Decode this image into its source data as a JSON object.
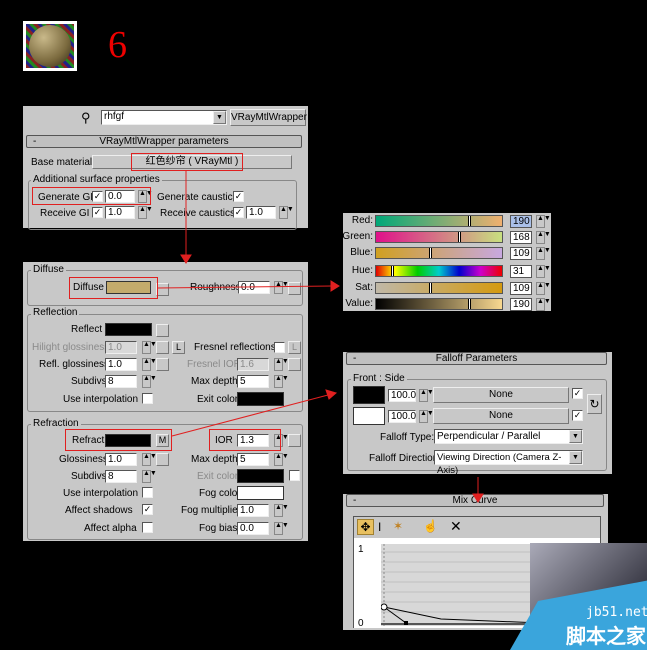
{
  "step_number": "6",
  "wrapper": {
    "material_name": "rhfgf",
    "type_button": "VRayMtlWrapper",
    "rollout_title": "VRayMtlWrapper parameters",
    "base_material_label": "Base material:",
    "base_material_value": "红色纱帘 ( VRayMtl )",
    "group_title": "Additional surface properties",
    "generate_gi_label": "Generate GI",
    "generate_gi_value": "0.0",
    "receive_gi_label": "Receive GI",
    "receive_gi_value": "1.0",
    "generate_caustics_label": "Generate caustics",
    "receive_caustics_label": "Receive caustics",
    "receive_caustics_value": "1.0",
    "check": "✓"
  },
  "vray": {
    "diffuse_group": "Diffuse",
    "diffuse_label": "Diffuse",
    "diffuse_color": "#c4ab6c",
    "roughness_label": "Roughness",
    "roughness_value": "0.0",
    "reflection_group": "Reflection",
    "reflect_label": "Reflect",
    "hilight_label": "Hilight glossiness",
    "hilight_value": "1.0",
    "l_button": "L",
    "fresnel_label": "Fresnel reflections",
    "refl_gloss_label": "Refl. glossiness",
    "refl_gloss_value": "1.0",
    "fresnel_ior_label": "Fresnel IOR",
    "fresnel_ior_value": "1.6",
    "subdivs_label": "Subdivs",
    "subdivs_value": "8",
    "max_depth_label": "Max depth",
    "max_depth_value": "5",
    "use_interp_label": "Use interpolation",
    "exit_color_label": "Exit color",
    "refraction_group": "Refraction",
    "refract_label": "Refract",
    "m_button": "M",
    "ior_label": "IOR",
    "ior_value": "1.3",
    "glossiness_label": "Glossiness",
    "glossiness_value": "1.0",
    "r_subdivs_value": "8",
    "r_max_depth_value": "5",
    "fog_color_label": "Fog color",
    "affect_shadows_label": "Affect shadows",
    "fog_mult_label": "Fog multiplier",
    "fog_mult_value": "1.0",
    "affect_alpha_label": "Affect alpha",
    "fog_bias_label": "Fog bias",
    "fog_bias_value": "0.0"
  },
  "color": {
    "rows": [
      {
        "label": "Red:",
        "value": "190",
        "pos": 0.745
      },
      {
        "label": "Green:",
        "value": "168",
        "pos": 0.66
      },
      {
        "label": "Blue:",
        "value": "109",
        "pos": 0.43
      },
      {
        "label": "Hue:",
        "value": "31",
        "pos": 0.12
      },
      {
        "label": "Sat:",
        "value": "109",
        "pos": 0.43
      },
      {
        "label": "Value:",
        "value": "190",
        "pos": 0.745
      }
    ]
  },
  "falloff": {
    "title": "Falloff Parameters",
    "group": "Front : Side",
    "front_value": "100.0",
    "side_value": "100.0",
    "none": "None",
    "type_label": "Falloff Type:",
    "type_value": "Perpendicular / Parallel",
    "direction_label": "Falloff Direction:",
    "direction_value": "Viewing Direction (Camera Z-Axis)",
    "front_color": "#000000",
    "side_color": "#ffffff"
  },
  "mix_curve": {
    "title": "Mix Curve",
    "y_max": "1",
    "y_min": "0"
  },
  "watermark": {
    "site": "jb51.net",
    "name": "脚本之家"
  }
}
